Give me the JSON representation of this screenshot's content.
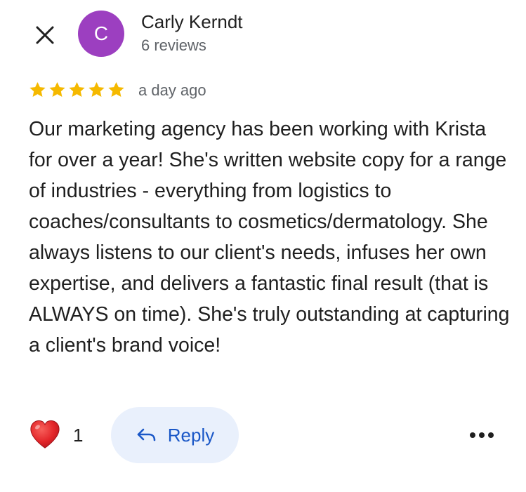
{
  "header": {
    "close_icon": "close-icon",
    "avatar_initial": "C",
    "avatar_color": "#9c3fc0",
    "author_name": "Carly Kerndt",
    "review_count": "6 reviews"
  },
  "review": {
    "rating": 5,
    "rating_max": 5,
    "star_color": "#f5b900",
    "time_ago": "a day ago",
    "text": "Our marketing agency has been working with Krista for over a year! She's written website copy for a range of industries - everything from logistics to coaches/consultants to cosmetics/dermatology. She always listens to our client's needs, infuses her own expertise, and delivers a fantastic final result (that is ALWAYS on time). She's truly outstanding at capturing a client's brand voice!"
  },
  "actions": {
    "like_icon": "heart-icon",
    "like_count": "1",
    "reply_icon": "reply-arrow-icon",
    "reply_label": "Reply",
    "reply_color": "#1a57c7",
    "more_icon": "more-options-icon"
  }
}
